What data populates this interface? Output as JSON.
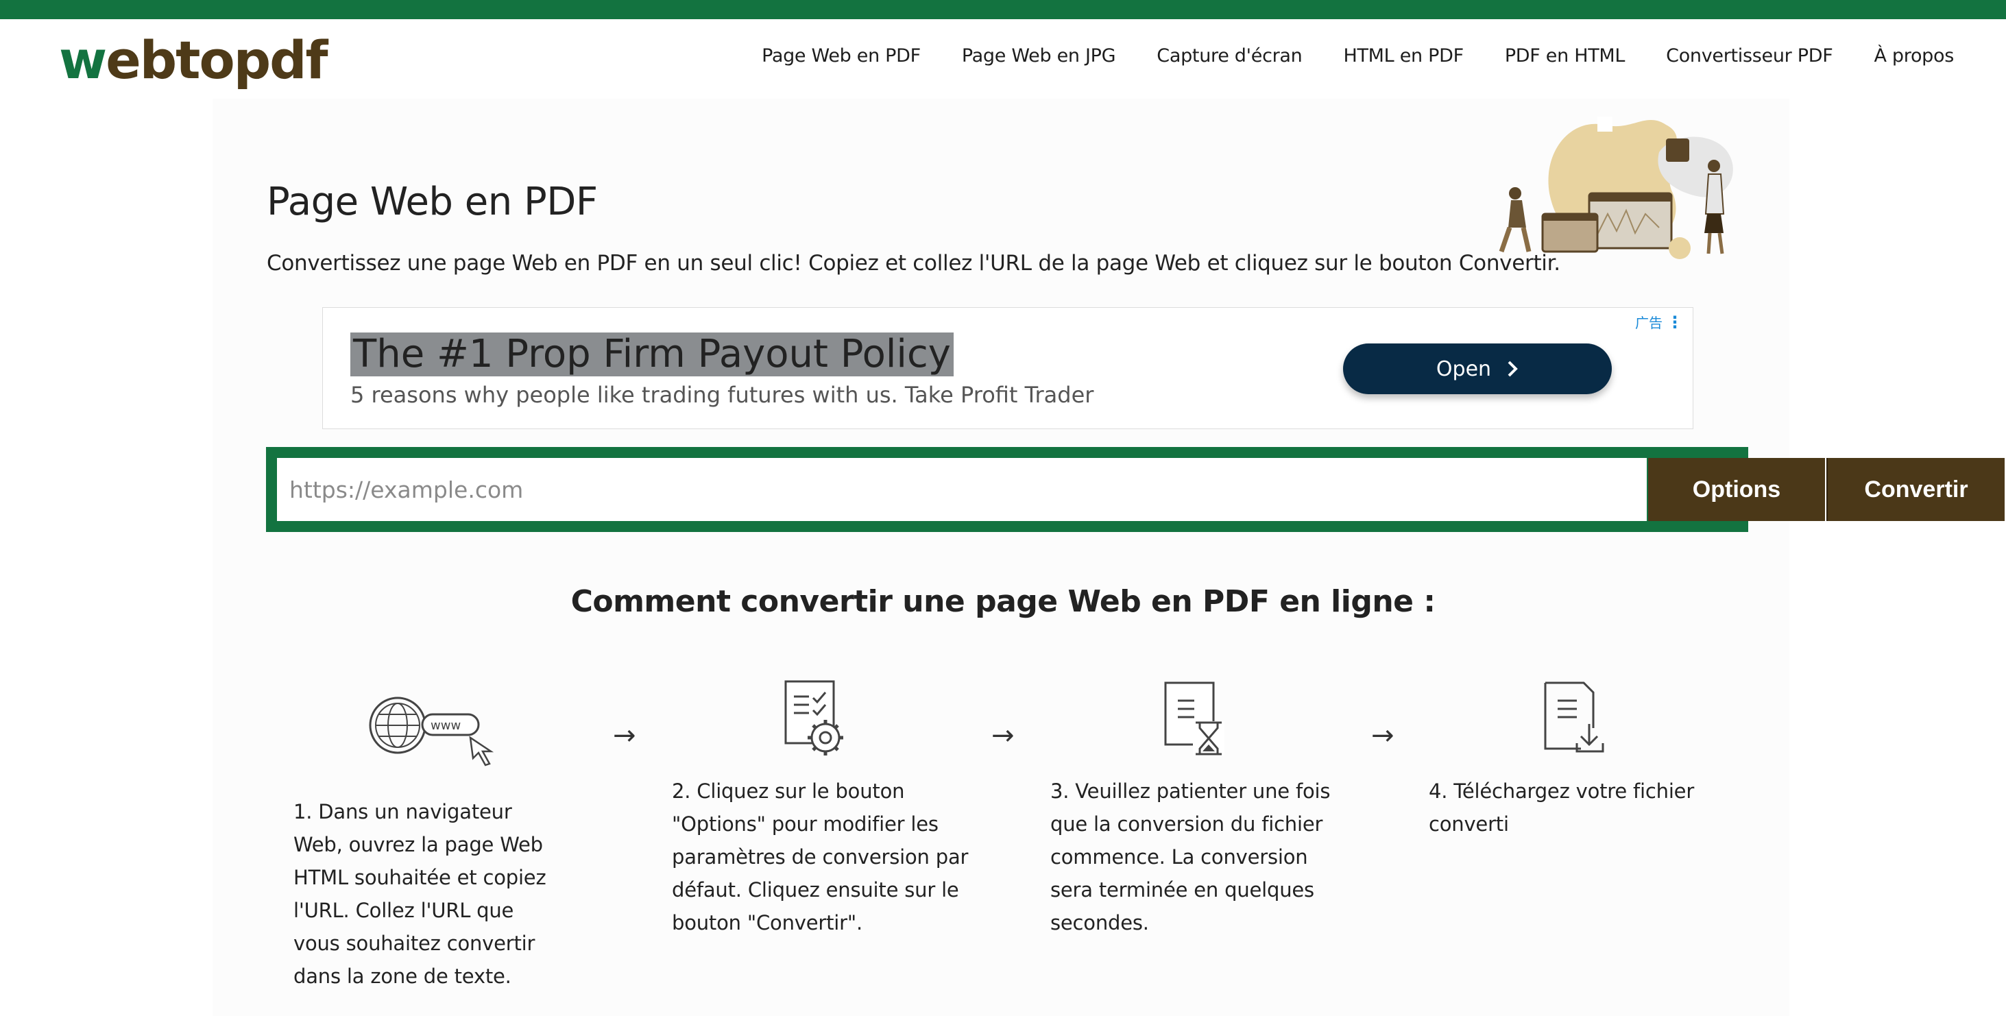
{
  "logo": {
    "part1": "w",
    "part2": "ebtopdf"
  },
  "nav": [
    "Page Web en PDF",
    "Page Web en JPG",
    "Capture d'écran",
    "HTML en PDF",
    "PDF en HTML",
    "Convertisseur PDF",
    "À propos"
  ],
  "page": {
    "title": "Page Web en PDF",
    "subtitle": "Convertissez une page Web en PDF en un seul clic! Copiez et collez l'URL de la page Web et cliquez sur le bouton Convertir."
  },
  "ad": {
    "title": "The #1 Prop Firm Payout Policy",
    "description": "5 reasons why people like trading futures with us. Take Profit Trader",
    "button": "Open",
    "tag": "广告"
  },
  "converter": {
    "placeholder": "https://example.com",
    "options_label": "Options",
    "convert_label": "Convertir"
  },
  "howto": {
    "title": "Comment convertir une page Web en PDF en ligne :",
    "steps": [
      {
        "icon": "globe-www-icon",
        "text": "1. Dans un navigateur Web, ouvrez la page Web HTML souhaitée et copiez l'URL. Collez l'URL que vous souhaitez convertir dans la zone de texte."
      },
      {
        "icon": "document-settings-icon",
        "text": "2. Cliquez sur le bouton \"Options\" pour modifier les paramètres de conversion par défaut. Cliquez ensuite sur le bouton \"Convertir\"."
      },
      {
        "icon": "document-hourglass-icon",
        "text": "3. Veuillez patienter une fois que la conversion du fichier commence. La conversion sera terminée en quelques secondes."
      },
      {
        "icon": "document-download-icon",
        "text": "4. Téléchargez votre fichier converti"
      }
    ],
    "arrow": "→"
  },
  "colors": {
    "brand_green": "#137340",
    "brand_brown": "#4b3818",
    "ad_button": "#082a45"
  }
}
